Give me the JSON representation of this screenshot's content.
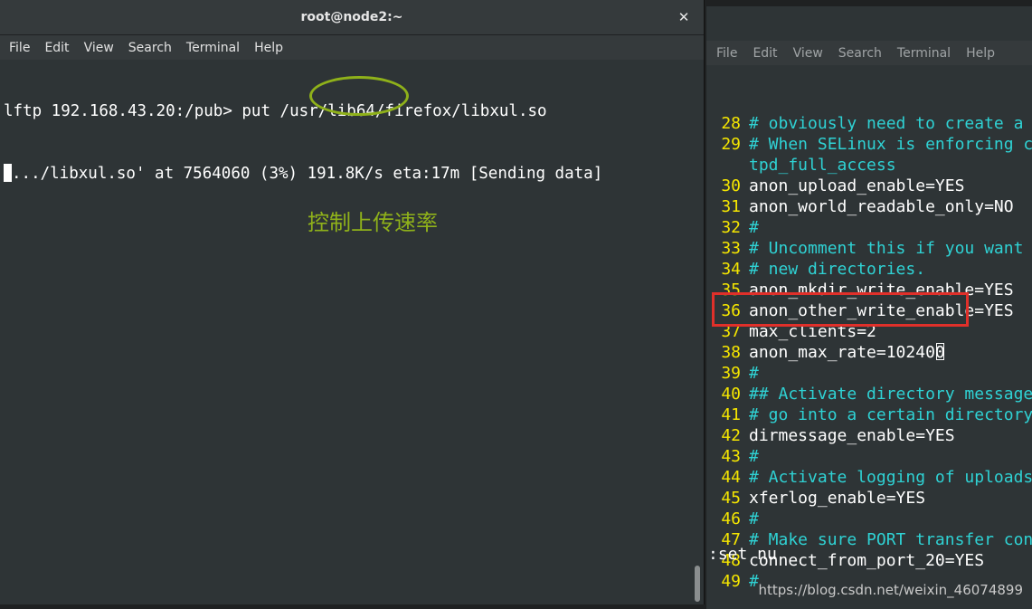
{
  "left_window": {
    "title": "root@node2:~",
    "close_glyph": "✕",
    "menu": [
      "File",
      "Edit",
      "View",
      "Search",
      "Terminal",
      "Help"
    ],
    "lines": [
      "lftp 192.168.43.20:/pub> put /usr/lib64/firefox/libxul.so",
      ".../libxul.so' at 7564060 (3%) 191.8K/s eta:17m [Sending data]"
    ],
    "annotation_text": "控制上传速率"
  },
  "right_window": {
    "menu": [
      "File",
      "Edit",
      "View",
      "Search",
      "Terminal",
      "Help"
    ],
    "editor_lines": [
      {
        "n": "28",
        "text": "# obviously need to create a",
        "kind": "comment"
      },
      {
        "n": "29",
        "text": "# When SELinux is enforcing c",
        "kind": "comment"
      },
      {
        "n": "",
        "text": "tpd_full_access",
        "kind": "comment"
      },
      {
        "n": "30",
        "text": "anon_upload_enable=YES",
        "kind": "code"
      },
      {
        "n": "31",
        "text": "anon_world_readable_only=NO",
        "kind": "code"
      },
      {
        "n": "32",
        "text": "#",
        "kind": "comment"
      },
      {
        "n": "33",
        "text": "# Uncomment this if you want",
        "kind": "comment"
      },
      {
        "n": "34",
        "text": "# new directories.",
        "kind": "comment"
      },
      {
        "n": "35",
        "text": "anon_mkdir_write_enable=YES",
        "kind": "code"
      },
      {
        "n": "36",
        "text": "anon_other_write_enable=YES",
        "kind": "code"
      },
      {
        "n": "37",
        "text": "max_clients=2",
        "kind": "code"
      },
      {
        "n": "38",
        "text": "anon_max_rate=102400",
        "kind": "code"
      },
      {
        "n": "39",
        "text": "#",
        "kind": "comment"
      },
      {
        "n": "40",
        "text": "## Activate directory message",
        "kind": "comment"
      },
      {
        "n": "41",
        "text": "# go into a certain directory",
        "kind": "comment"
      },
      {
        "n": "42",
        "text": "dirmessage_enable=YES",
        "kind": "code"
      },
      {
        "n": "43",
        "text": "#",
        "kind": "comment"
      },
      {
        "n": "44",
        "text": "# Activate logging of uploads",
        "kind": "comment"
      },
      {
        "n": "45",
        "text": "xferlog_enable=YES",
        "kind": "code"
      },
      {
        "n": "46",
        "text": "#",
        "kind": "comment"
      },
      {
        "n": "47",
        "text": "# Make sure PORT transfer con",
        "kind": "comment"
      },
      {
        "n": "48",
        "text": "connect_from_port_20=YES",
        "kind": "code"
      },
      {
        "n": "49",
        "text": "#",
        "kind": "comment"
      }
    ],
    "command_line": ":set nu",
    "watermark": "https://blog.csdn.net/weixin_46074899"
  },
  "colors": {
    "terminal_bg": "#2e3436",
    "line_number": "#f5e600",
    "comment": "#2fd2d4",
    "annotation_green": "#8fb11a",
    "highlight_red": "#e0302a"
  }
}
